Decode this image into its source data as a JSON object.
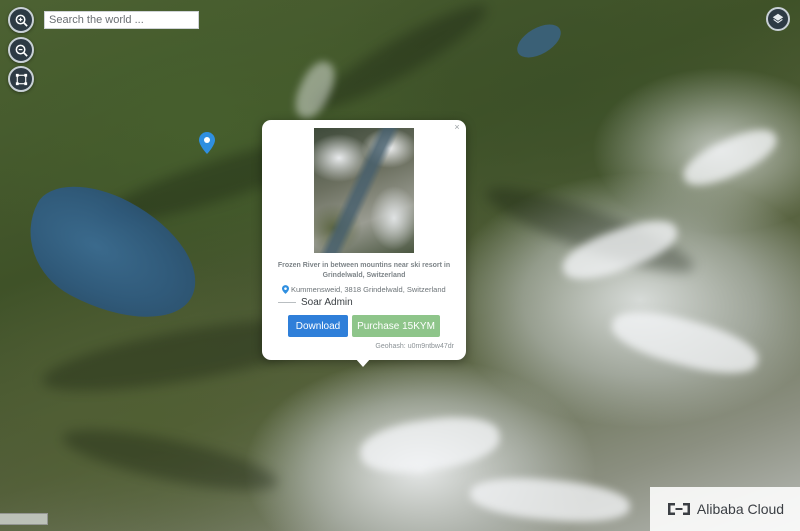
{
  "search": {
    "placeholder": "Search the world ..."
  },
  "controls": {
    "zoom_in_icon": "zoom-in-icon",
    "zoom_out_icon": "zoom-out-icon",
    "fullscreen_icon": "fullscreen-icon",
    "layers_icon": "layers-icon"
  },
  "popup": {
    "title": "Frozen River in between mountins near ski resort in Grindelwald, Switzerland",
    "address": "Kummensweid, 3818 Grindelwald, Switzerland",
    "author": "Soar Admin",
    "download_label": "Download",
    "purchase_label": "Purchase 15KYM",
    "geohash": "Geohash: u0m9ntbw47dr",
    "close_label": "×"
  },
  "watermark": {
    "text": "Alibaba Cloud"
  },
  "colors": {
    "download": "#2f7fd9",
    "purchase": "#8ec58a",
    "pin": "#2f8fe0"
  }
}
